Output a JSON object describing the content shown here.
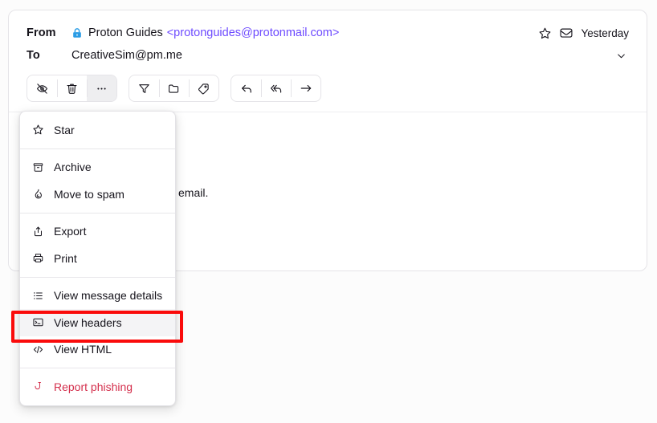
{
  "email": {
    "from_label": "From",
    "to_label": "To",
    "sender_name": "Proton Guides",
    "sender_email": "<protonguides@protonmail.com>",
    "recipient": "CreativeSim@pm.me",
    "timestamp": "Yesterday",
    "body_fragment": "email.",
    "lock_icon": "lock-icon",
    "star_icon": "star-icon",
    "inbox_icon": "inbox-icon",
    "expand_icon": "chevron-down-icon"
  },
  "toolbar": {
    "group_left": [
      {
        "name": "mark-unread-button",
        "icon": "eye-slash-icon",
        "active": false
      },
      {
        "name": "delete-button",
        "icon": "trash-icon",
        "active": false
      },
      {
        "name": "more-options-button",
        "icon": "ellipsis-icon",
        "active": true
      }
    ],
    "group_mid": [
      {
        "name": "filter-button",
        "icon": "filter-icon"
      },
      {
        "name": "move-to-folder-button",
        "icon": "folder-icon"
      },
      {
        "name": "label-button",
        "icon": "tag-icon"
      }
    ],
    "group_right": [
      {
        "name": "reply-button",
        "icon": "reply-icon"
      },
      {
        "name": "reply-all-button",
        "icon": "reply-all-icon"
      },
      {
        "name": "forward-button",
        "icon": "forward-icon"
      }
    ]
  },
  "menu": {
    "groups": [
      {
        "items": [
          {
            "label": "Star",
            "icon": "star-icon",
            "name": "menu-item-star",
            "state": "normal"
          }
        ]
      },
      {
        "items": [
          {
            "label": "Archive",
            "icon": "archive-icon",
            "name": "menu-item-archive",
            "state": "normal"
          },
          {
            "label": "Move to spam",
            "icon": "fire-icon",
            "name": "menu-item-move-to-spam",
            "state": "normal"
          }
        ]
      },
      {
        "items": [
          {
            "label": "Export",
            "icon": "export-icon",
            "name": "menu-item-export",
            "state": "normal"
          },
          {
            "label": "Print",
            "icon": "printer-icon",
            "name": "menu-item-print",
            "state": "normal"
          }
        ]
      },
      {
        "items": [
          {
            "label": "View message details",
            "icon": "list-icon",
            "name": "menu-item-view-message-details",
            "state": "normal"
          },
          {
            "label": "View headers",
            "icon": "terminal-icon",
            "name": "menu-item-view-headers",
            "state": "highlighted"
          },
          {
            "label": "View HTML",
            "icon": "code-icon",
            "name": "menu-item-view-html",
            "state": "normal"
          }
        ]
      },
      {
        "items": [
          {
            "label": "Report phishing",
            "icon": "hook-icon",
            "name": "menu-item-report-phishing",
            "state": "danger"
          }
        ]
      }
    ]
  },
  "annotation": {
    "target": "View headers",
    "color": "#fa0b0b"
  },
  "colors": {
    "brand_purple": "#6d4aff",
    "lock_blue": "#2a9ce5",
    "danger_red": "#d42f4c",
    "annotation_red": "#fa0b0b",
    "text": "#16141c",
    "border": "#e5e4e8",
    "page_bg": "#fcfcfc"
  }
}
